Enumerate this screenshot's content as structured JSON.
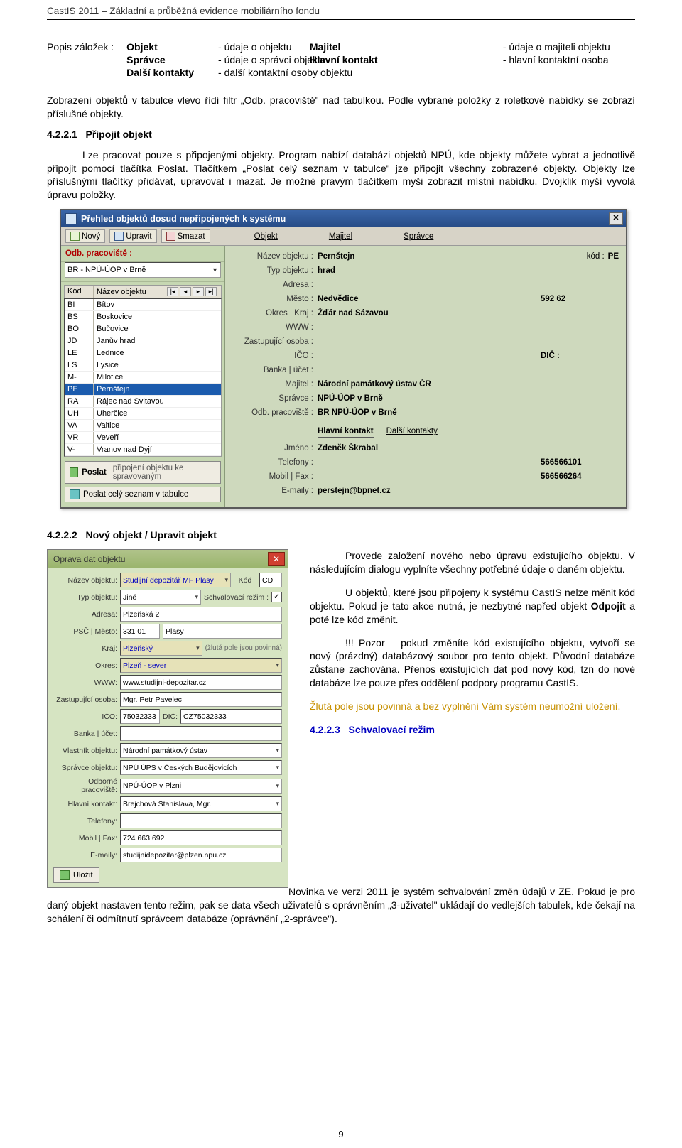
{
  "doc": {
    "header": "CastIS 2011 – Základní a průběžná evidence mobiliárního fondu",
    "pagenum": "9"
  },
  "intro": {
    "label_lead": "Popis záložek :",
    "cols": [
      [
        "Objekt",
        "- údaje o objektu",
        "Majitel",
        "- údaje o majiteli objektu"
      ],
      [
        "Správce",
        "- údaje o správci objektu",
        "Hlavní kontakt",
        "- hlavní kontaktní osoba"
      ],
      [
        "Další kontakty",
        "- další kontaktní osoby objektu",
        "",
        ""
      ]
    ],
    "p_filter": "Zobrazení objektů v tabulce vlevo řídí filtr „Odb. pracoviště\" nad tabulkou. Podle vybrané položky z roletkové nabídky se zobrazí příslušné objekty."
  },
  "sec4221": {
    "num": "4.2.2.1",
    "title": "Připojit objekt",
    "p": "Lze pracovat pouze s připojenými objekty. Program nabízí databázi objektů NPÚ, kde objekty můžete vybrat a jednotlivě připojit pomocí tlačítka Poslat. Tlačítkem „Poslat celý seznam v tabulce\" jze připojit všechny zobrazené objekty. Objekty lze příslušnými tlačítky přidávat, upravovat i mazat. Je možné pravým tlačítkem myši zobrazit místní nabídku. Dvojklik myší vyvolá úpravu položky.",
    "bold_words": [
      "Poslat"
    ]
  },
  "win1": {
    "title": "Přehled objektů dosud nepřipojených k systému",
    "toolbar": {
      "novy": "Nový",
      "upravit": "Upravit",
      "smazat": "Smazat",
      "links": [
        "Objekt",
        "Majitel",
        "Správce"
      ]
    },
    "combo_label": "Odb. pracoviště :",
    "combo_value": "BR - NPÚ-ÚOP v Brně",
    "list_headers": {
      "c1": "Kód",
      "c2": "Název objektu"
    },
    "rows": [
      [
        "BI",
        "Bítov"
      ],
      [
        "BS",
        "Boskovice"
      ],
      [
        "BO",
        "Bučovice"
      ],
      [
        "JD",
        "Janův hrad"
      ],
      [
        "LE",
        "Lednice"
      ],
      [
        "LS",
        "Lysice"
      ],
      [
        "M-",
        "Milotice"
      ],
      [
        "PE",
        "Pernštejn"
      ],
      [
        "RA",
        "Rájec nad Svitavou"
      ],
      [
        "UH",
        "Uherčice"
      ],
      [
        "VA",
        "Valtice"
      ],
      [
        "VR",
        "Veveří"
      ],
      [
        "V-",
        "Vranov nad Dyjí"
      ]
    ],
    "selected_index": 7,
    "btn_poslat": "Poslat",
    "btn_poslat_note": "připojení objektu ke spravovaným",
    "btn_poslat_all": "Poslat celý seznam v tabulce",
    "form": {
      "fields": [
        [
          "Název objektu :",
          "Pernštejn",
          "kód : PE"
        ],
        [
          "Typ objektu :",
          "hrad",
          ""
        ],
        [
          "Adresa :",
          "",
          ""
        ],
        [
          "Město :",
          "Nedvědice",
          "592 62"
        ],
        [
          "Okres | Kraj :",
          "Žďár nad Sázavou",
          ""
        ],
        [
          "WWW :",
          "",
          ""
        ],
        [
          "Zastupující osoba :",
          "",
          ""
        ],
        [
          "IČO :",
          "",
          "DIČ :"
        ],
        [
          "Banka | účet :",
          "",
          ""
        ],
        [
          "Majitel :",
          "Národní památkový ústav ČR",
          ""
        ],
        [
          "Správce :",
          "NPÚ-ÚOP v Brně",
          ""
        ],
        [
          "Odb. pracoviště :",
          "BR NPÚ-ÚOP v Brně",
          ""
        ]
      ],
      "tabs": [
        "Hlavní kontakt",
        "Další kontakty"
      ],
      "contact": [
        [
          "Jméno :",
          "Zdeněk Škrabal",
          ""
        ],
        [
          "Telefony :",
          "",
          "566566101"
        ],
        [
          "Mobil | Fax :",
          "",
          "566566264"
        ],
        [
          "E-maily :",
          "perstejn@bpnet.cz",
          ""
        ]
      ]
    }
  },
  "sec4222": {
    "num": "4.2.2.2",
    "title": "Nový objekt / Upravit objekt"
  },
  "shot2": {
    "title": "Oprava dat objektu",
    "rows": {
      "nazev_lbl": "Název objektu:",
      "nazev": "Studijní depozitář MF Plasy",
      "kod_lbl": "Kód",
      "kod": "CD",
      "typ_lbl": "Typ objektu:",
      "typ": "Jiné",
      "schv_lbl": "Schvalovací režim :",
      "schv_checked": true,
      "adresa_lbl": "Adresa:",
      "adresa": "Plzeňská 2",
      "psc_lbl": "PSČ | Město:",
      "psc": "331 01",
      "mesto": "Plasy",
      "kraj_lbl": "Kraj:",
      "kraj": "Plzeňský",
      "yellow_hint": "(žlutá pole jsou povinná)",
      "okres_lbl": "Okres:",
      "okres": "Plzeň - sever",
      "www_lbl": "WWW:",
      "www": "www.studijni-depozitar.cz",
      "zast_lbl": "Zastupující osoba:",
      "zast": "Mgr. Petr Pavelec",
      "ico_lbl": "IČO:",
      "ico": "75032333",
      "dic_lbl": "DIČ:",
      "dic": "CZ75032333",
      "banka_lbl": "Banka | účet:",
      "banka": "",
      "vlast_lbl": "Vlastník objektu:",
      "vlast": "Národní památkový ústav",
      "sprav_lbl": "Správce objektu:",
      "sprav": "NPÚ ÚPS v Českých Budějovicích",
      "prac_lbl": "Odborné pracoviště:",
      "prac": "NPÚ-ÚOP v Plzni",
      "kont_lbl": "Hlavní kontakt:",
      "kont": "Brejchová Stanislava, Mgr.",
      "tel_lbl": "Telefony:",
      "tel": "",
      "mob_lbl": "Mobil | Fax:",
      "mob": "724 663 692",
      "mail_lbl": "E-maily:",
      "mail": "studijnidepozitar@plzen.npu.cz"
    },
    "btn_ulozit": "Uložit"
  },
  "right_text": {
    "p1": "Provede založení nového nebo úpravu existujícího objektu. V následujícím dialogu vyplníte všechny potřebné údaje o daném objektu.",
    "p2a": "U objektů, které jsou připojeny k systému CastIS nelze měnit kód objektu. Pokud je tato akce nutná, je nezbytné napřed objekt ",
    "p2b": "Odpojit",
    "p2c": " a poté lze kód změnit.",
    "p3": "!!! Pozor – pokud změníte kód existujícího objektu, vytvoří se nový (prázdný) databázový soubor pro tento objekt. Původní databáze zůstane zachována. Přenos existujících dat pod nový kód, tzn do nové databáze lze pouze přes oddělení podpory programu CastIS.",
    "warn": "Žlutá pole jsou povinná a bez vyplnění Vám systém neumožní uložení."
  },
  "sec4223": {
    "num": "4.2.2.3",
    "title": "Schvalovací režim",
    "p": "Novinka ve verzi 2011 je systém schvalování změn údajů v ZE. Pokud je pro daný objekt nastaven tento režim, pak se data všech uživatelů s oprávněním „3-uživatel\" ukládají do vedlejších tabulek, kde čekají na schálení či odmítnutí správcem databáze (oprávnění „2-správce\")."
  }
}
